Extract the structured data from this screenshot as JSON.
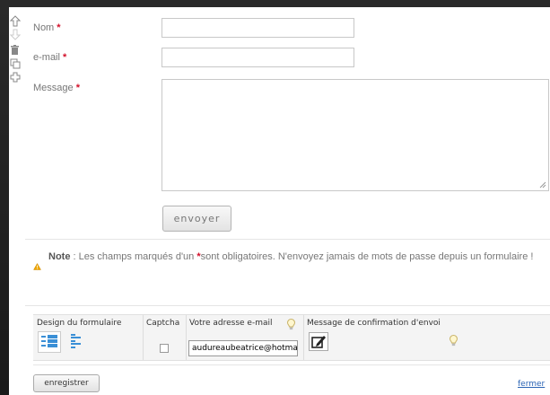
{
  "form": {
    "fields": [
      {
        "label": "Nom",
        "required_mark": "*"
      },
      {
        "label": "e-mail",
        "required_mark": "*"
      },
      {
        "label": "Message",
        "required_mark": "*"
      }
    ],
    "submit_label": "envoyer"
  },
  "note": {
    "title": "Note",
    "text_before": " : Les champs marqués d'un ",
    "required_mark": "*",
    "text_after": "sont obligatoires. N'envoyez jamais de mots de passe depuis un formulaire !"
  },
  "options": {
    "design_label": "Design du formulaire",
    "captcha_label": "Captcha",
    "email_label": "Votre adresse e-mail",
    "email_value": "audureaubeatrice@hotmail.fr",
    "confirm_label": "Message de confirmation d'envoi"
  },
  "footer": {
    "save_label": "enregistrer",
    "close_label": "fermer"
  },
  "colors": {
    "required": "#d2102a",
    "link": "#2a63b4",
    "accent_icon": "#3a8fd6"
  }
}
